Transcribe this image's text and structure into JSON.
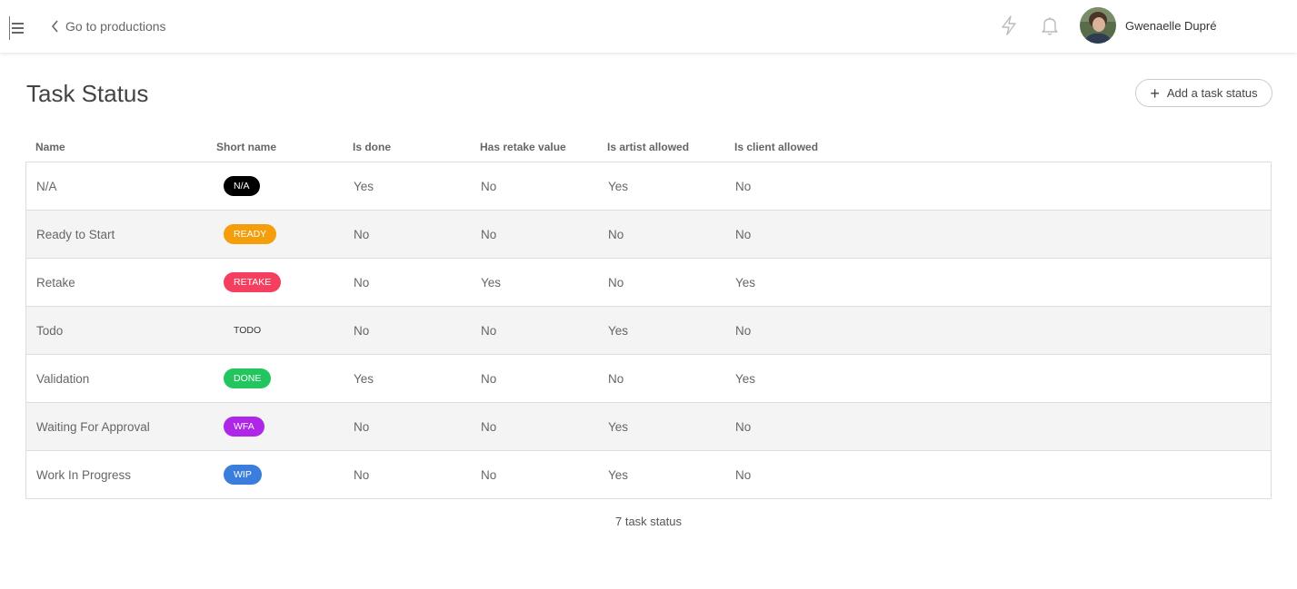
{
  "header": {
    "back_label": "Go to productions",
    "user_name": "Gwenaelle Dupré"
  },
  "page": {
    "title": "Task Status",
    "add_button_label": "Add a task status"
  },
  "table": {
    "columns": [
      "Name",
      "Short name",
      "Is done",
      "Has retake value",
      "Is artist allowed",
      "Is client allowed"
    ],
    "rows": [
      {
        "name": "N/A",
        "short": "N/A",
        "color": "#000000",
        "text_color": "#ffffff",
        "done": "Yes",
        "retake": "No",
        "artist": "Yes",
        "client": "No"
      },
      {
        "name": "Ready to Start",
        "short": "READY",
        "color": "#f59e0b",
        "text_color": "#ffffff",
        "done": "No",
        "retake": "No",
        "artist": "No",
        "client": "No"
      },
      {
        "name": "Retake",
        "short": "RETAKE",
        "color": "#f43f5e",
        "text_color": "#ffffff",
        "done": "No",
        "retake": "Yes",
        "artist": "No",
        "client": "Yes"
      },
      {
        "name": "Todo",
        "short": "TODO",
        "color": "#f4f4f4",
        "text_color": "#333333",
        "done": "No",
        "retake": "No",
        "artist": "Yes",
        "client": "No"
      },
      {
        "name": "Validation",
        "short": "DONE",
        "color": "#22c55e",
        "text_color": "#ffffff",
        "done": "Yes",
        "retake": "No",
        "artist": "No",
        "client": "Yes"
      },
      {
        "name": "Waiting For Approval",
        "short": "WFA",
        "color": "#b026e8",
        "text_color": "#ffffff",
        "done": "No",
        "retake": "No",
        "artist": "Yes",
        "client": "No"
      },
      {
        "name": "Work In Progress",
        "short": "WIP",
        "color": "#3b7ddd",
        "text_color": "#ffffff",
        "done": "No",
        "retake": "No",
        "artist": "Yes",
        "client": "No"
      }
    ]
  },
  "footer": {
    "count_label": "7 task status"
  }
}
